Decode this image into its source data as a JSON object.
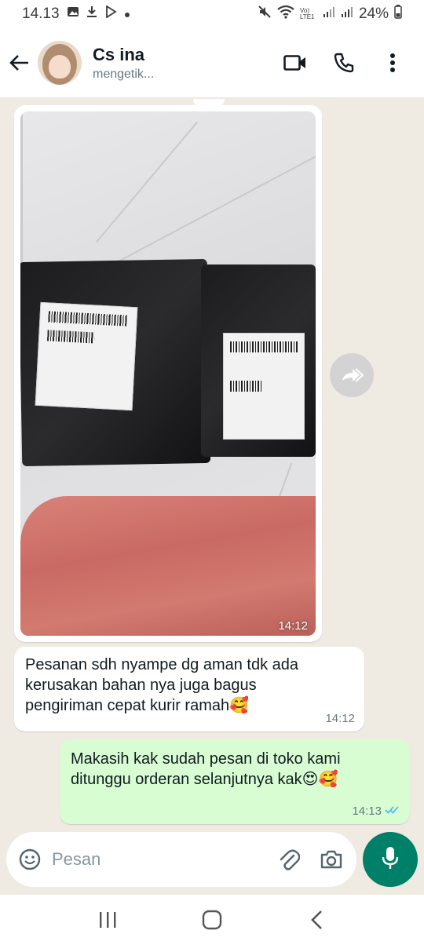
{
  "status_bar": {
    "time": "14.13",
    "network_label": "Vo) LTE1",
    "battery": "24%"
  },
  "header": {
    "contact_name": "Cs ina",
    "contact_status": "mengetik..."
  },
  "messages": [
    {
      "type": "image",
      "direction": "incoming",
      "time": "14:12"
    },
    {
      "type": "text",
      "direction": "incoming",
      "text": "Pesanan sdh nyampe dg aman tdk ada kerusakan bahan nya juga bagus pengiriman cepat kurir ramah🥰",
      "time": "14:12"
    },
    {
      "type": "text",
      "direction": "outgoing",
      "text": "Makasih kak sudah pesan di toko kami ditunggu orderan selanjutnya kak😍🥰",
      "time": "14:13",
      "read": true
    }
  ],
  "input": {
    "placeholder": "Pesan"
  },
  "colors": {
    "accent": "#008069",
    "outgoing_bubble": "#d9fdd3",
    "chat_background": "#efeae2",
    "read_ticks": "#53bdeb"
  },
  "icons": {
    "header": [
      "back-arrow-icon",
      "video-call-icon",
      "phone-icon",
      "more-vert-icon"
    ],
    "input": [
      "emoji-icon",
      "attach-icon",
      "camera-icon",
      "mic-icon"
    ],
    "nav": [
      "recents-icon",
      "home-icon",
      "back-icon"
    ]
  }
}
